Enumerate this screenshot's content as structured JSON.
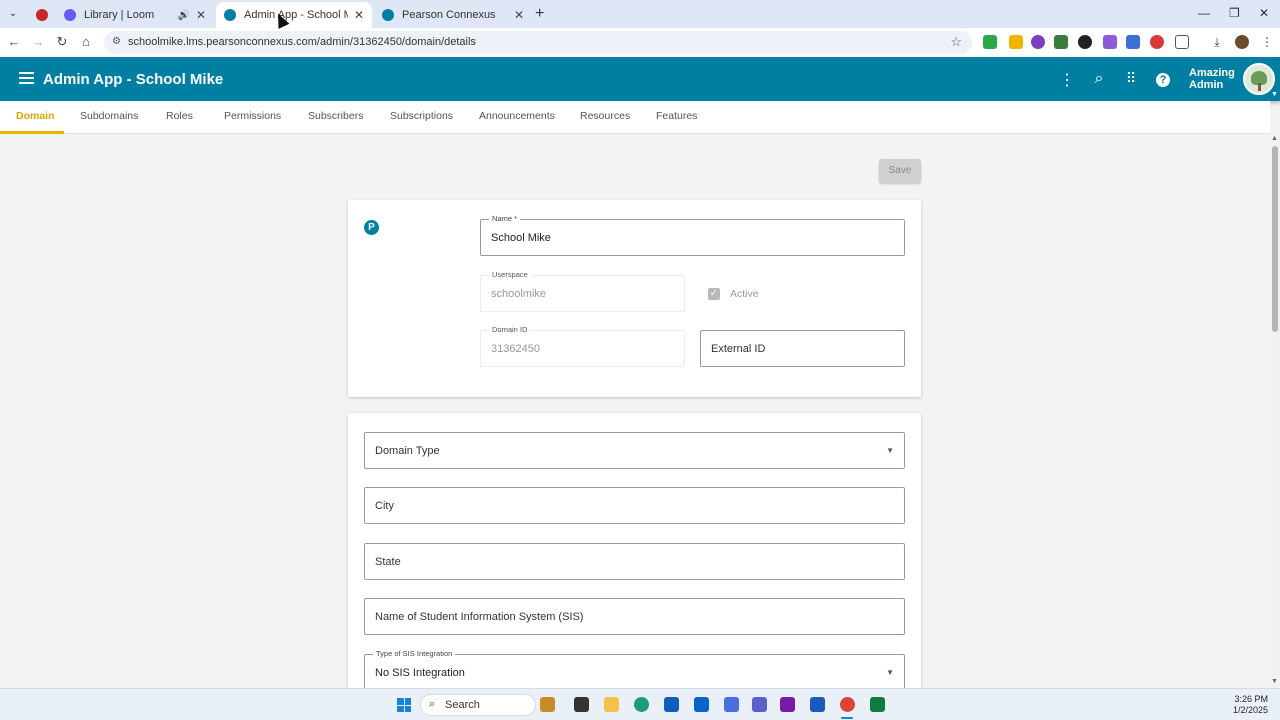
{
  "browser": {
    "tabs": [
      {
        "title": "",
        "favicon_color": "#c62828",
        "icon": "record-icon"
      },
      {
        "title": "Library | Loom",
        "favicon_color": "#625df5",
        "icon": "loom-icon",
        "audio": true
      },
      {
        "title": "Admin App - School Mike",
        "favicon_color": "#007fa3",
        "icon": "pearson-icon",
        "active": true
      },
      {
        "title": "Pearson Connexus",
        "favicon_color": "#007fa3",
        "icon": "pearson-icon"
      }
    ],
    "url": "schoolmike.lms.pearsonconnexus.com/admin/31362450/domain/details"
  },
  "app": {
    "title": "Admin App - School Mike",
    "user_line1": "Amazing",
    "user_line2": "Admin",
    "brand_color": "#007fa3"
  },
  "nav": {
    "tabs": [
      "Domain",
      "Subdomains",
      "Roles",
      "Permissions",
      "Subscribers",
      "Subscriptions",
      "Announcements",
      "Resources",
      "Features"
    ],
    "active": "Domain",
    "accent_color": "#e8b400"
  },
  "toolbar": {
    "save_label": "Save"
  },
  "form": {
    "logo_letter": "P",
    "name": {
      "label": "Name *",
      "value": "School Mike"
    },
    "userspace": {
      "label": "Userspace",
      "value": "schoolmike"
    },
    "active": {
      "label": "Active",
      "checked": true
    },
    "domain_id": {
      "label": "Domain ID",
      "value": "31362450"
    },
    "external_id": {
      "placeholder": "External ID"
    },
    "domain_type": {
      "placeholder": "Domain Type"
    },
    "city": {
      "placeholder": "City"
    },
    "state": {
      "placeholder": "State"
    },
    "sis_name": {
      "placeholder": "Name of Student Information System (SIS)"
    },
    "sis_type": {
      "label": "Type of SIS Integration",
      "value": "No SIS Integration"
    }
  },
  "taskbar": {
    "search_label": "Search",
    "time": "3:26 PM",
    "date": "1/2/2025"
  }
}
